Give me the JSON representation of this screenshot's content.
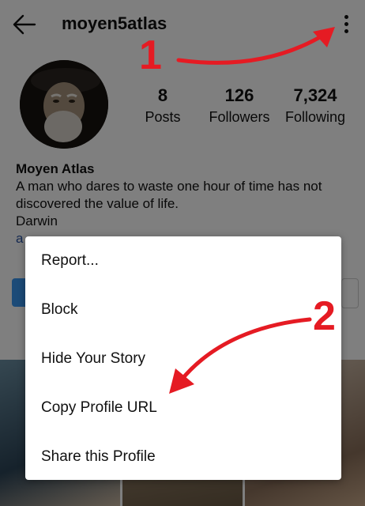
{
  "header": {
    "username": "moyen5atlas",
    "back_icon": "arrow-left-icon",
    "more_icon": "vertical-dots-icon"
  },
  "stats": [
    {
      "value": "8",
      "label": "Posts"
    },
    {
      "value": "126",
      "label": "Followers"
    },
    {
      "value": "7,324",
      "label": "Following"
    }
  ],
  "bio": {
    "name": "Moyen Atlas",
    "text": "A man who dares to waste one hour of time has not discovered the value of life.",
    "author": "Darwin",
    "link": "a"
  },
  "menu": {
    "items": [
      {
        "label": "Report..."
      },
      {
        "label": "Block"
      },
      {
        "label": "Hide Your Story"
      },
      {
        "label": "Copy Profile URL"
      },
      {
        "label": "Share this Profile"
      }
    ]
  },
  "annotations": {
    "step1": "1",
    "step2": "2",
    "color": "#e51b23"
  }
}
